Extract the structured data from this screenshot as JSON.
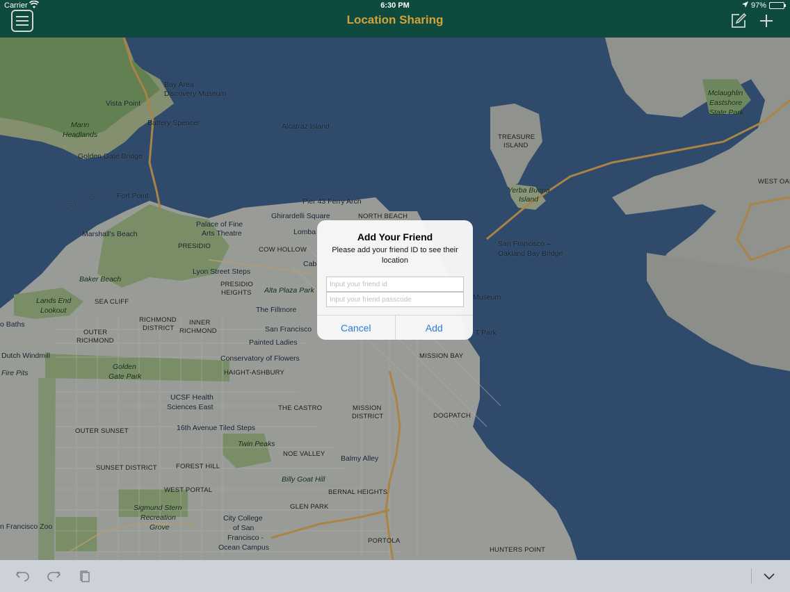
{
  "status_bar": {
    "carrier": "Carrier",
    "time": "6:30 PM",
    "battery": "97%",
    "battery_level": 0.97
  },
  "nav": {
    "title": "Location Sharing",
    "title_color": "#d4a338",
    "bar_color": "#0e4a3d"
  },
  "map": {
    "labels": {
      "bay_area_museum_1": "Bay Area",
      "bay_area_museum_2": "Discovery Museum",
      "vista_point": "Vista Point",
      "battery_spencer": "Battery Spencer",
      "marin_1": "Marin",
      "marin_2": "Headlands",
      "golden_gate_bridge": "Golden Gate Bridge",
      "alcatraz": "Alcatraz Island",
      "treasure_1": "TREASURE",
      "treasure_2": "ISLAND",
      "mclaughlin_1": "Mclaughlin",
      "mclaughlin_2": "Eastshore",
      "mclaughlin_3": "State Park",
      "yerba_1": "Yerba Buena",
      "yerba_2": "Island",
      "fort_point": "Fort Point",
      "golden_gate_water": "Golden Gate",
      "pier43": "Pier 43 Ferry Arch",
      "ghirardelli": "Ghirardelli Square",
      "north_beach": "NORTH BEACH",
      "palace_1": "Palace of Fine",
      "palace_2": "Arts Theatre",
      "marshalls": "Marshall's Beach",
      "presidio": "PRESIDIO",
      "cow_hollow": "COW HOLLOW",
      "lombard": "Lomba",
      "sf_oakland_1": "San Francisco –",
      "sf_oakland_2": "Oakland Bay Bridge",
      "lyon": "Lyon Street Steps",
      "cab": "Cab",
      "baker_beach": "Baker Beach",
      "presidio_h_1": "PRESIDIO",
      "presidio_h_2": "HEIGHTS",
      "alta_plaza": "Alta Plaza Park",
      "lands_end_1": "Lands End",
      "lands_end_2": "Lookout",
      "sea_cliff": "SEA CLIFF",
      "fillmore": "The Fillmore",
      "museum": "Museum",
      "richmond_d_1": "RICHMOND",
      "richmond_d_2": "DISTRICT",
      "inner_r_1": "INNER",
      "inner_r_2": "RICHMOND",
      "outer_r_1": "OUTER",
      "outer_r_2": "RICHMOND",
      "baths": "o Baths",
      "sf_partial": "San Francisco",
      "painted_ladies": "Painted Ladies",
      "t_park": "T Park",
      "dutch_windmill": "Dutch Windmill",
      "conservatory": "Conservatory of Flowers",
      "mission_bay": "MISSION BAY",
      "fire_pits": "Fire Pits",
      "ggpark_1": "Golden",
      "ggpark_2": "Gate Park",
      "haight": "HAIGHT-ASHBURY",
      "ucsf_1": "UCSF Health",
      "ucsf_2": "Sciences East",
      "castro": "THE CASTRO",
      "mission_1": "MISSION",
      "mission_2": "DISTRICT",
      "dogpatch": "DOGPATCH",
      "outer_sunset": "OUTER SUNSET",
      "tiled_steps": "16th Avenue Tiled Steps",
      "twin_peaks": "Twin Peaks",
      "noe_valley": "NOE VALLEY",
      "sunset_district": "SUNSET DISTRICT",
      "forest_hill": "FOREST HILL",
      "balmy_alley": "Balmy Alley",
      "billy_goat": "Billy Goat Hill",
      "west_portal": "WEST PORTAL",
      "bernal": "BERNAL HEIGHTS",
      "sigmund_1": "Sigmund Stern",
      "sigmund_2": "Recreation",
      "sigmund_3": "Grove",
      "glen_park": "GLEN PARK",
      "city_college_1": "City College",
      "city_college_2": "of San",
      "city_college_3": "Francisco -",
      "city_college_4": "Ocean Campus",
      "sf_zoo": "n Francisco Zoo",
      "portola": "PORTOLA",
      "hunters_point": "HUNTERS POINT",
      "west_oak": "WEST OAK"
    }
  },
  "dialog": {
    "title": "Add Your Friend",
    "message": "Please add your friend ID to see their location",
    "friend_id_placeholder": "Input your friend id",
    "passcode_placeholder": "Input your friend passcode",
    "cancel_label": "Cancel",
    "add_label": "Add",
    "button_color": "#2a7ad6"
  },
  "toolbar": {
    "undo_icon": "undo-icon",
    "redo_icon": "redo-icon",
    "paste_icon": "clipboard-icon",
    "collapse_icon": "chevron-down-icon"
  }
}
